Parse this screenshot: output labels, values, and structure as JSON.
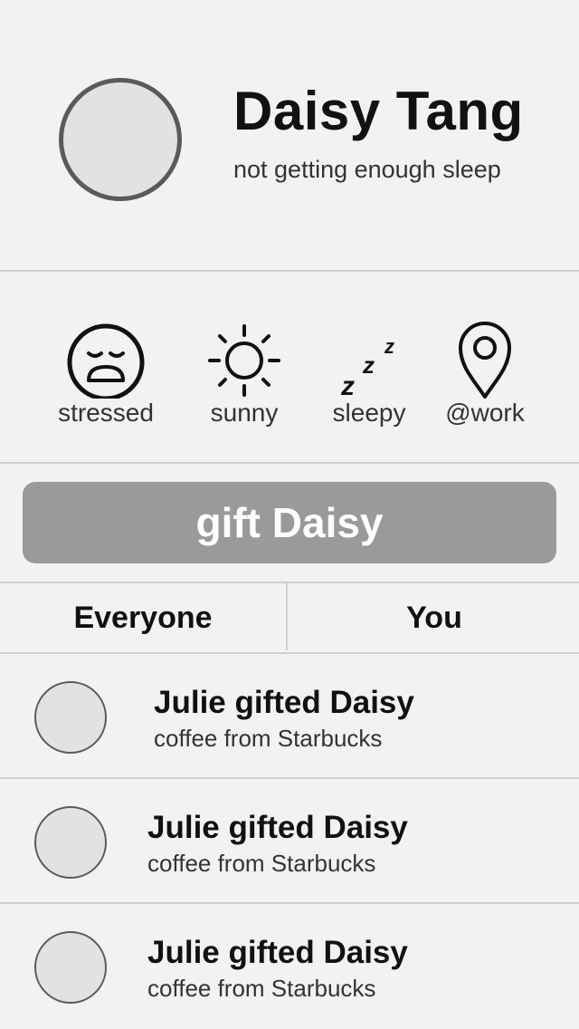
{
  "profile": {
    "name": "Daisy Tang",
    "status": "not getting enough sleep"
  },
  "moods": [
    {
      "label": "stressed",
      "icon": "stressed-face-icon"
    },
    {
      "label": "sunny",
      "icon": "sun-icon"
    },
    {
      "label": "sleepy",
      "icon": "zzz-sleep-icon"
    },
    {
      "label": "@work",
      "icon": "location-pin-icon"
    }
  ],
  "gift_button": {
    "label": "gift Daisy"
  },
  "tabs": [
    {
      "label": "Everyone"
    },
    {
      "label": "You"
    }
  ],
  "feed": [
    {
      "title": "Julie gifted Daisy",
      "subtitle": "coffee from Starbucks"
    },
    {
      "title": "Julie gifted Daisy",
      "subtitle": "coffee from Starbucks"
    },
    {
      "title": "Julie gifted Daisy",
      "subtitle": "coffee from Starbucks"
    }
  ],
  "colors": {
    "background": "#f2f2f2",
    "button": "#9a9a9a",
    "divider": "#cfcfcf"
  }
}
